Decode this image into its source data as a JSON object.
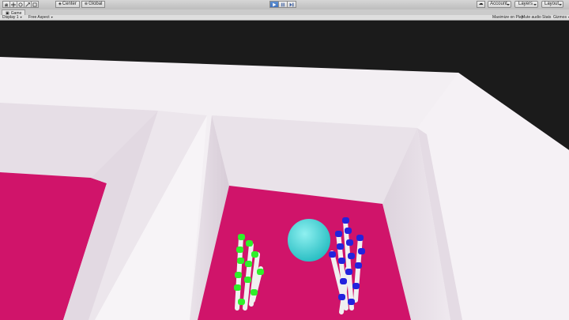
{
  "toolbar": {
    "tools": [
      {
        "icon": "hand-icon"
      },
      {
        "icon": "move-icon"
      },
      {
        "icon": "rotate-icon"
      },
      {
        "icon": "scale-icon"
      },
      {
        "icon": "rect-tool-icon"
      }
    ],
    "pivot_label": "Center",
    "space_label": "Global",
    "play_icon": "play-icon",
    "pause_icon": "pause-icon",
    "step_icon": "step-icon",
    "account_label": "Account",
    "layers_label": "Layers",
    "layout_label": "Layout"
  },
  "game_view": {
    "tab_label": "Game",
    "display_label": "Display 1",
    "aspect_label": "Free Aspect",
    "maximize_label": "Maximize on Play",
    "mute_label": "Mute audio",
    "stats_label": "Stats",
    "gizmos_label": "Gizmos"
  },
  "colors": {
    "accent_active": "#4a7dc9",
    "floor_magenta": "#d0146a",
    "wall_white": "#f2eef2",
    "sphere_cyan": "#45d3d6",
    "left_hand_green": "#2ff02a",
    "right_hand_blue": "#2222dd"
  }
}
